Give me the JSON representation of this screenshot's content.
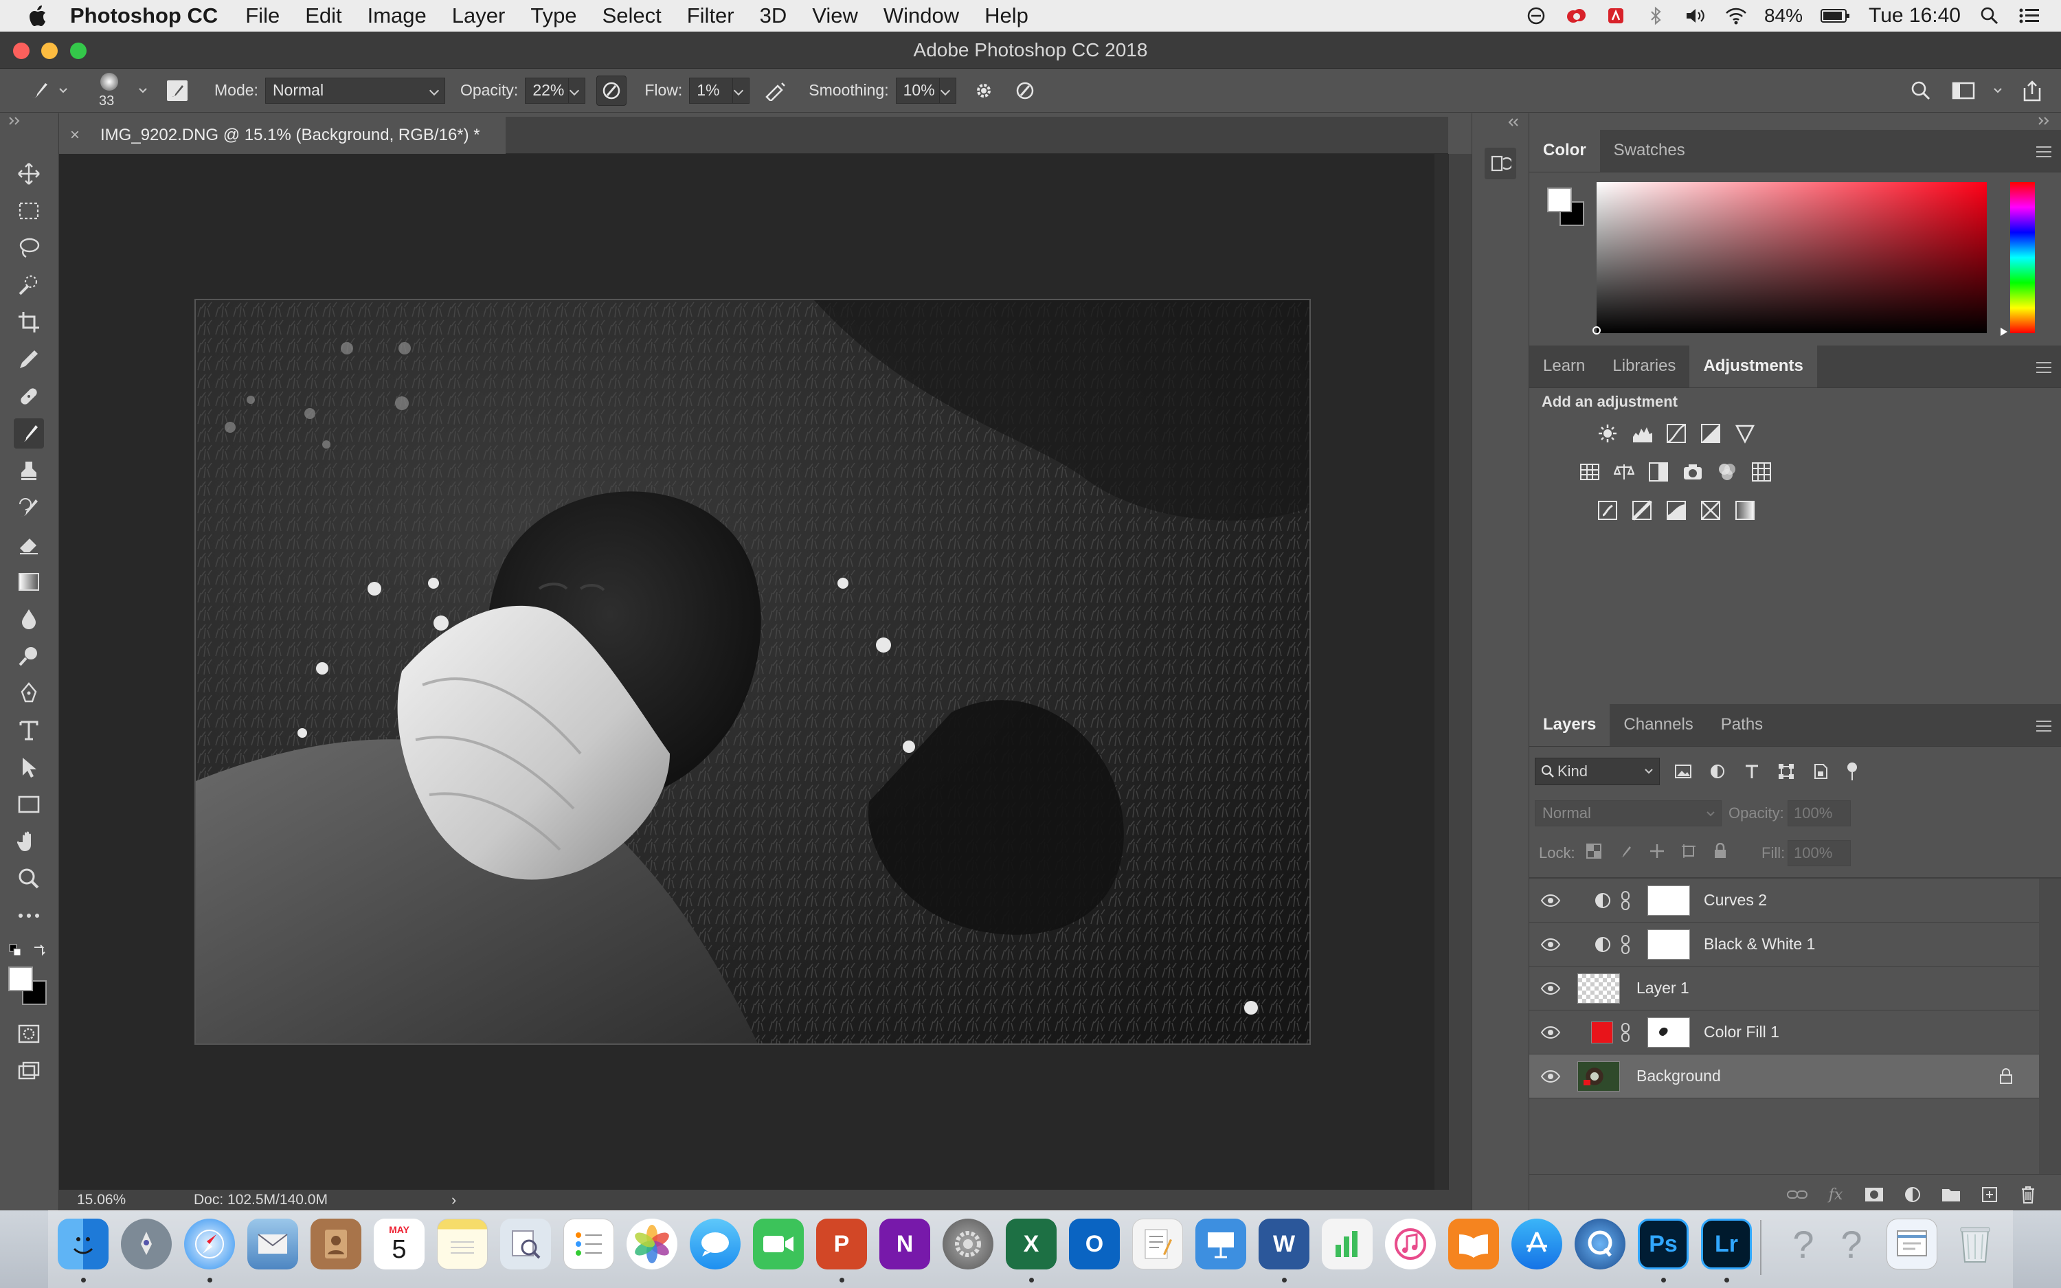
{
  "menubar": {
    "app_name": "Photoshop CC",
    "items": [
      "File",
      "Edit",
      "Image",
      "Layer",
      "Type",
      "Select",
      "Filter",
      "3D",
      "View",
      "Window",
      "Help"
    ],
    "battery": "84%",
    "clock": "Tue 16:40"
  },
  "window": {
    "title": "Adobe Photoshop CC 2018"
  },
  "options": {
    "brush_size": "33",
    "mode_label": "Mode:",
    "mode_value": "Normal",
    "opacity_label": "Opacity:",
    "opacity_value": "22%",
    "flow_label": "Flow:",
    "flow_value": "1%",
    "smoothing_label": "Smoothing:",
    "smoothing_value": "10%"
  },
  "document": {
    "tab_title": "IMG_9202.DNG @ 15.1% (Background, RGB/16*) *",
    "zoom": "15.06%",
    "doc_size": "Doc: 102.5M/140.0M"
  },
  "color_panel": {
    "tabs": [
      "Color",
      "Swatches"
    ],
    "hue_color": "#ff0017"
  },
  "adjust_panel": {
    "tabs": [
      "Learn",
      "Libraries",
      "Adjustments"
    ],
    "heading": "Add an adjustment"
  },
  "layers_panel": {
    "tabs": [
      "Layers",
      "Channels",
      "Paths"
    ],
    "filter_kind": "Kind",
    "blend_mode": "Normal",
    "opacity_label": "Opacity:",
    "opacity_value": "100%",
    "lock_label": "Lock:",
    "fill_label": "Fill:",
    "fill_value": "100%",
    "layers": [
      {
        "name": "Curves 2",
        "type": "adjustment"
      },
      {
        "name": "Black & White 1",
        "type": "adjustment"
      },
      {
        "name": "Layer 1",
        "type": "pixel"
      },
      {
        "name": "Color Fill 1",
        "type": "fill",
        "fill_color": "#e8141a"
      },
      {
        "name": "Background",
        "type": "background",
        "selected": true,
        "locked": true
      }
    ]
  },
  "dock": {
    "apps": [
      "Finder",
      "Launchpad",
      "Safari",
      "Mail",
      "Contacts",
      "Calendar",
      "Notes",
      "Preview",
      "Reminders",
      "Photos",
      "Messages",
      "FaceTime",
      "PowerPoint",
      "OneNote",
      "System Preferences",
      "Excel",
      "Outlook",
      "TextEdit",
      "Keynote",
      "Word",
      "Numbers",
      "iTunes",
      "iBooks",
      "App Store",
      "QuickTime",
      "Photoshop",
      "Lightroom",
      "Help",
      "Help",
      "Downloads",
      "Trash"
    ],
    "calendar_day": "5",
    "calendar_month": "MAY",
    "ps_label": "Ps",
    "lr_label": "Lr",
    "word_label": "W",
    "excel_label": "X",
    "ppt_label": "P",
    "onenote_label": "N",
    "outlook_label": "O"
  }
}
